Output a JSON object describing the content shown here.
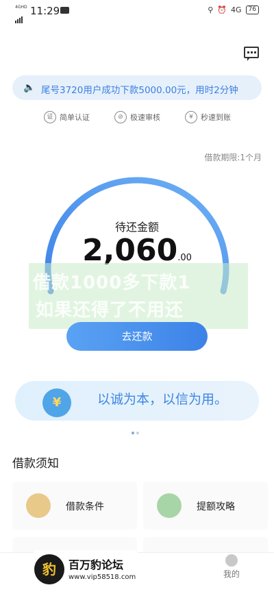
{
  "status_bar": {
    "signal": "4GHD",
    "time": "11:29",
    "right_net": "4G",
    "battery": "76"
  },
  "notice": {
    "text": "尾号3720用户成功下款5000.00元，用时2分钟"
  },
  "features": [
    {
      "icon": "证",
      "label": "简单认证"
    },
    {
      "icon": "⊘",
      "label": "极速审核"
    },
    {
      "icon": "¥",
      "label": "秒速到账"
    }
  ],
  "loan_term": "借款期限:1个月",
  "repay": {
    "title": "待还金额",
    "amount": "2,060",
    "decimal": ".00",
    "button": "去还款"
  },
  "overlay_watermark": {
    "line1": "借款1000多下款1",
    "line2": "如果还得了不用还"
  },
  "banner": {
    "text": "以诚为本，以信为用。"
  },
  "section_title": "借款须知",
  "cards": [
    {
      "label": "借款条件",
      "color": "#e8c98a"
    },
    {
      "label": "提额攻略",
      "color": "#a8d5a8"
    }
  ],
  "nav": {
    "me": "我的"
  },
  "forum_watermark": {
    "name": "百万豹论坛",
    "url": "www.vip58518.com"
  },
  "colors": {
    "accent": "#3d82e8",
    "notice_bg": "#e6f0fb"
  }
}
